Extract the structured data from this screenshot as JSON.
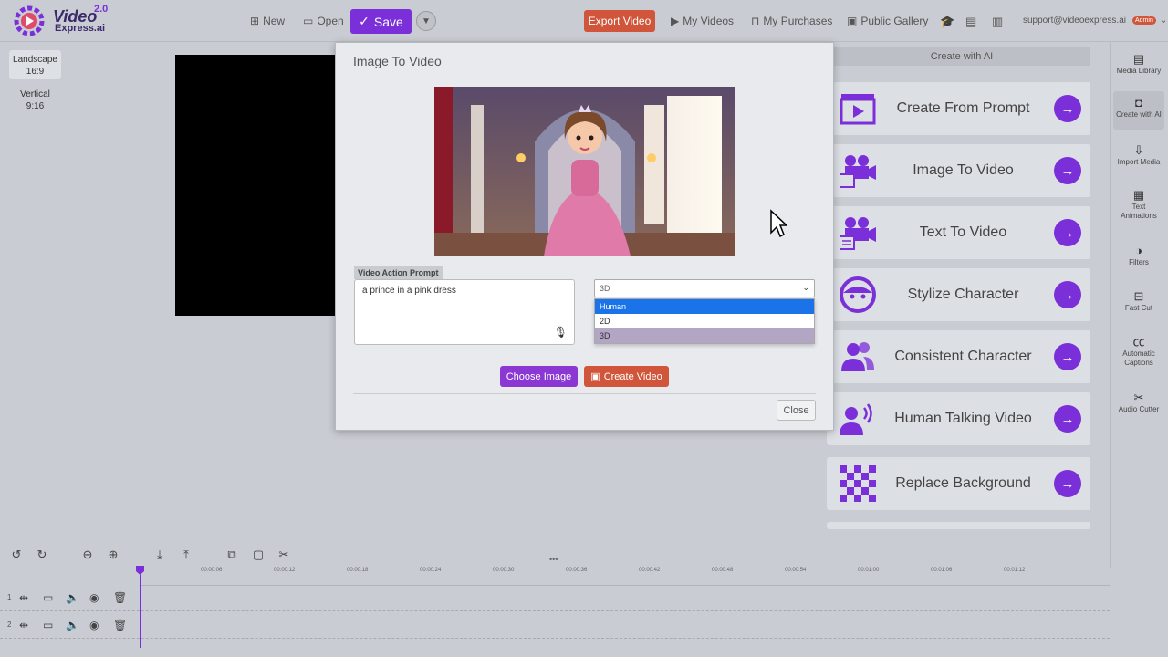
{
  "header": {
    "logo_line1": "Video",
    "logo_line2": "Express.ai",
    "logo_version": "2.0",
    "new_label": "New",
    "open_label": "Open",
    "save_label": "Save",
    "export_label": "Export Video",
    "my_videos_label": "My Videos",
    "my_purchases_label": "My Purchases",
    "public_gallery_label": "Public Gallery",
    "user_email": "support@videoexpress.ai",
    "admin_badge": "Admin"
  },
  "ratios": [
    {
      "line1": "Landscape",
      "line2": "16:9"
    },
    {
      "line1": "Vertical",
      "line2": "9:16"
    }
  ],
  "right_panel": {
    "title": "Create with AI",
    "cards": [
      {
        "label": "Create From Prompt",
        "icon": "clapperboard-icon"
      },
      {
        "label": "Image To Video",
        "icon": "video-camera-image-icon"
      },
      {
        "label": "Text To Video",
        "icon": "video-camera-text-icon"
      },
      {
        "label": "Stylize Character",
        "icon": "character-face-icon"
      },
      {
        "label": "Consistent Character",
        "icon": "users-icon"
      },
      {
        "label": "Human Talking Video",
        "icon": "talking-person-icon"
      },
      {
        "label": "Replace Background",
        "icon": "checkerboard-icon"
      }
    ]
  },
  "sidebar": {
    "items": [
      {
        "label": "Media Library",
        "icon": "media-library-icon"
      },
      {
        "label": "Create with AI",
        "icon": "robot-icon"
      },
      {
        "label": "Import Media",
        "icon": "import-icon"
      },
      {
        "label": "Text Animations",
        "icon": "film-icon"
      },
      {
        "label": "Filters",
        "icon": "filter-icon"
      },
      {
        "label": "Fast Cut",
        "icon": "fast-cut-icon"
      },
      {
        "label": "Automatic Captions",
        "icon": "captions-icon"
      },
      {
        "label": "Audio Cutter",
        "icon": "scissors-icon"
      }
    ]
  },
  "timeline": {
    "ticks": [
      "00:00:06",
      "00:00:12",
      "00:00:18",
      "00:00:24",
      "00:00:30",
      "00:00:36",
      "00:00:42",
      "00:00:48",
      "00:00:54",
      "00:01:00",
      "00:01:06",
      "00:01:12"
    ],
    "track_numbers": [
      "1",
      "2"
    ]
  },
  "modal": {
    "title": "Image To Video",
    "prompt_label": "Video Action Prompt",
    "prompt_value": "a prince in a pink dress",
    "select_value": "3D",
    "options": [
      "Human",
      "2D",
      "3D"
    ],
    "choose_image_label": "Choose Image",
    "create_video_label": "Create Video",
    "close_label": "Close"
  },
  "colors": {
    "accent": "#7b2fd8",
    "export": "#d0553a",
    "background": "#c9ccd2"
  }
}
